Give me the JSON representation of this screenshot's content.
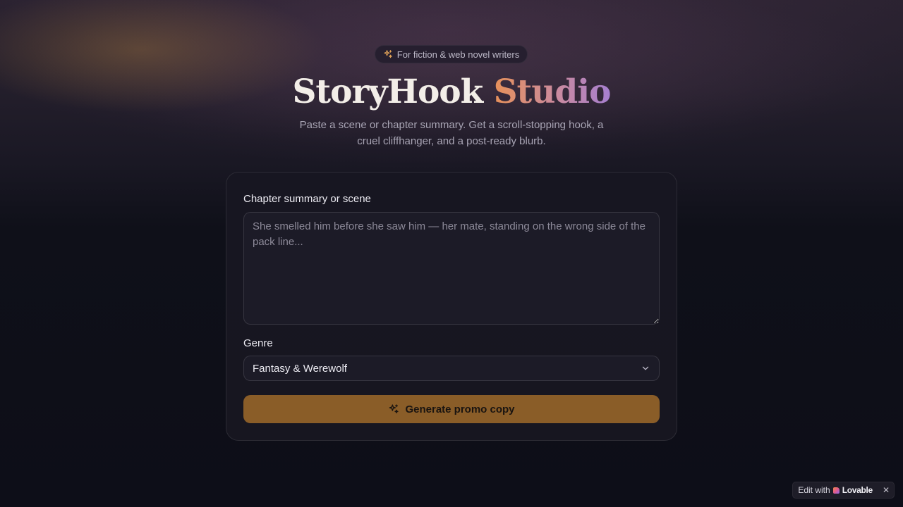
{
  "badge_top": {
    "label": "For fiction & web novel writers",
    "icon": "sparkles-icon",
    "icon_color": "#e4a55a"
  },
  "hero": {
    "title_main": "StoryHook",
    "title_accent": "Studio",
    "subtitle": "Paste a scene or chapter summary. Get a scroll-stopping hook, a cruel cliffhanger, and a post-ready blurb."
  },
  "form": {
    "summary_label": "Chapter summary or scene",
    "summary_placeholder": "She smelled him before she saw him — her mate, standing on the wrong side of the pack line...",
    "summary_value": "",
    "genre_label": "Genre",
    "genre_value": "Fantasy & Werewolf",
    "submit_label": "Generate promo copy",
    "submit_icon": "sparkles-icon",
    "submit_color": "#8a5d28"
  },
  "footer_badge": {
    "prefix": "Edit with",
    "brand": "Lovable",
    "close": "✕"
  },
  "colors": {
    "background": "#0e0f19",
    "card": "#181722",
    "accent_start": "#e7915a",
    "accent_end": "#a67fd0"
  }
}
